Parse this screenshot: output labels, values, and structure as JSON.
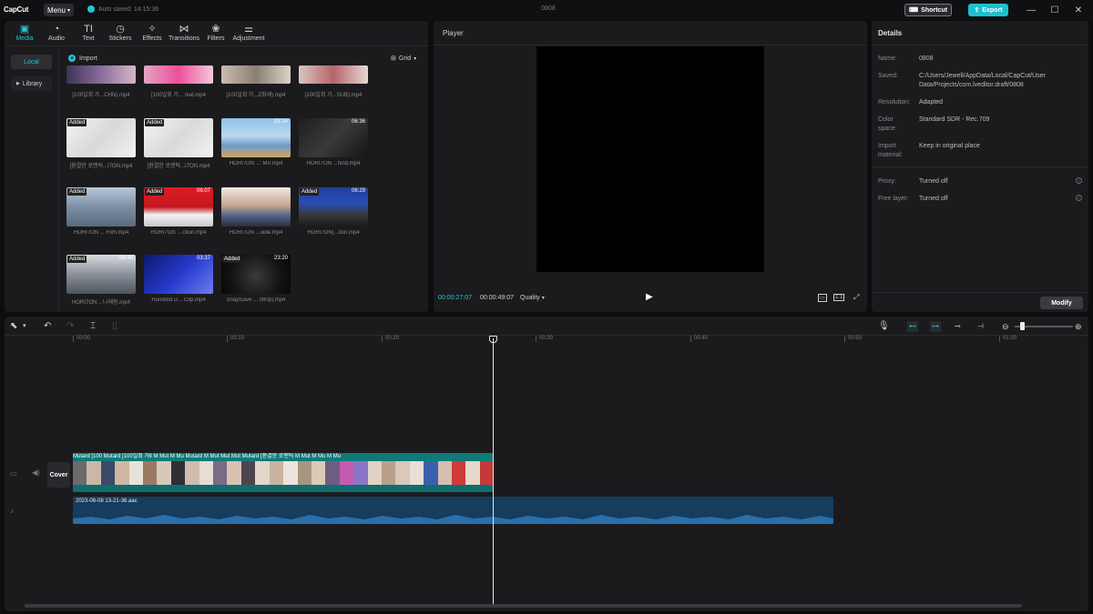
{
  "titlebar": {
    "logo": "CapCut",
    "menu_label": "Menu",
    "autosave_text": "Auto saved: 14:15:36",
    "project_name": "0808",
    "shortcut_label": "Shortcut",
    "export_label": "Export",
    "minimize": "—",
    "maximize": "☐",
    "close": "✕"
  },
  "media": {
    "tabs": [
      {
        "label": "Media",
        "icon": "media-icon"
      },
      {
        "label": "Audio",
        "icon": "audio-icon"
      },
      {
        "label": "Text",
        "icon": "text-icon"
      },
      {
        "label": "Stickers",
        "icon": "stickers-icon"
      },
      {
        "label": "Effects",
        "icon": "effects-icon"
      },
      {
        "label": "Transitions",
        "icon": "transitions-icon"
      },
      {
        "label": "Filters",
        "icon": "filters-icon"
      },
      {
        "label": "Adjustment",
        "icon": "adjustment-icon"
      }
    ],
    "sidebar": {
      "local": "Local",
      "library": "Library"
    },
    "import_label": "Import",
    "view_label": "Grid",
    "items": [
      {
        "badge": "",
        "duration": "",
        "caption": "[100일회 가...CHN).mp4"
      },
      {
        "badge": "",
        "duration": "",
        "caption": "[100일회 가... real.mp4"
      },
      {
        "badge": "",
        "duration": "",
        "caption": "[100일회 가...Z화재).mp4"
      },
      {
        "badge": "",
        "duration": "",
        "caption": "[100일회 가...SUB).mp4"
      },
      {
        "badge": "Added",
        "duration": "",
        "caption": "[환결한 로맨틱...I7ON.mp4"
      },
      {
        "badge": "Added",
        "duration": "",
        "caption": "[환결한 로맨틱...I7ON.mp4"
      },
      {
        "badge": "",
        "duration": "03:14",
        "caption": "HORI7ON ...' MV.mp4"
      },
      {
        "badge": "",
        "duration": "06:36",
        "caption": "HORI7ON ...hind.mp4"
      },
      {
        "badge": "Added",
        "duration": "",
        "caption": "HORI7ON ... Film.mp4"
      },
      {
        "badge": "Added",
        "duration": "06:07",
        "caption": "HORI7ON '...ction.mp4"
      },
      {
        "badge": "",
        "duration": "",
        "caption": "HORI7ON ...uide.mp4"
      },
      {
        "badge": "Added",
        "duration": "06:29",
        "caption": "HORI7ON(...tion.mp4"
      },
      {
        "badge": "Added",
        "duration": "06:46",
        "caption": "HORI7ON ...나래동.mp4"
      },
      {
        "badge": "",
        "duration": "03:37",
        "caption": "Hundred D... Clip.mp4"
      },
      {
        "badge": "Added",
        "duration": "23:20",
        "caption": "SnapSave ... 080p).mp4"
      }
    ]
  },
  "player": {
    "title": "Player",
    "time_current": "00:00:27:07",
    "time_total": "00:00:49:07",
    "quality_label": "Quality",
    "ratio_label": "1:1"
  },
  "details": {
    "title": "Details",
    "fields": [
      {
        "label": "Name:",
        "value": "0808"
      },
      {
        "label": "Saved:",
        "value": "C:/Users/Jewell/AppData/Local/CapCut/User Data/Projects/com.lveditor.draft/0808"
      },
      {
        "label": "Resolution:",
        "value": "Adapted"
      },
      {
        "label": "Color space:",
        "value": "Standard SDR - Rec.709"
      },
      {
        "label": "Import material:",
        "value": "Keep in original place"
      },
      {
        "label": "Proxy:",
        "value": "Turned off"
      },
      {
        "label": "Free layer:",
        "value": "Turned off"
      }
    ],
    "modify_label": "Modify"
  },
  "timeline": {
    "ruler": [
      "00:00",
      "00:10",
      "00:20",
      "00:30",
      "00:40",
      "00:50",
      "01:00"
    ],
    "cover_label": "Cover",
    "video_clip_labels": "Mutard  [100  Mutard  [100일회 가Ⅱ  M   Mut  M  Mu  Mutard  M  Mut  Mut  Mut  Mutard  [환결한 로맨틱  M  Mut  M  Mu  M  Mu",
    "audio_clip_label": "2023-08-08 13-21-36.aac"
  },
  "colors": {
    "accent": "#22c7d4",
    "video_track": "#0f7a78",
    "audio_track": "#163c5e"
  }
}
